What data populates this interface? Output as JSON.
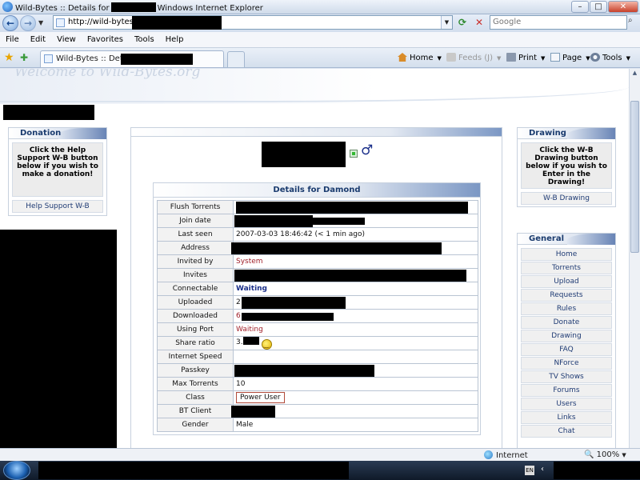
{
  "window": {
    "title_prefix": "Wild-Bytes :: Details for",
    "title_suffix": "Windows Internet Explorer"
  },
  "addressbar": {
    "url": "http://wild-bytes.org",
    "search_placeholder": "Google"
  },
  "menubar": [
    "File",
    "Edit",
    "View",
    "Favorites",
    "Tools",
    "Help"
  ],
  "tab": {
    "title": "Wild-Bytes :: Details for"
  },
  "commandbar": {
    "home": "Home",
    "feeds": "Feeds (J)",
    "print": "Print",
    "page": "Page",
    "tools": "Tools"
  },
  "site": {
    "logo": "Welcome to Wild-Bytes.org"
  },
  "donation": {
    "title": "Donation",
    "text": "Click the Help Support W-B button below if you wish to make a donation!",
    "link": "Help Support W-B"
  },
  "drawing": {
    "title": "Drawing",
    "text": "Click the W-B Drawing button below if you wish to Enter in the Drawing!",
    "link": "W-B Drawing"
  },
  "general": {
    "title": "General",
    "items": [
      "Home",
      "Torrents",
      "Upload",
      "Requests",
      "Rules",
      "Donate",
      "Drawing",
      "FAQ",
      "NForce",
      "TV Shows",
      "Forums",
      "Users",
      "Links",
      "Chat"
    ]
  },
  "details": {
    "title": "Details for Damond",
    "labels": {
      "flush": "Flush Torrents",
      "join": "Join date",
      "lastseen": "Last seen",
      "address": "Address",
      "invitedby": "Invited by",
      "invites": "Invites",
      "connectable": "Connectable",
      "uploaded": "Uploaded",
      "downloaded": "Downloaded",
      "port": "Using Port",
      "ratio": "Share ratio",
      "speed": "Internet Speed",
      "passkey": "Passkey",
      "maxtorrents": "Max Torrents",
      "class": "Class",
      "btclient": "BT Client",
      "gender": "Gender"
    },
    "values": {
      "lastseen": "2007-03-03 18:46:42 (< 1 min ago)",
      "invitedby": "System",
      "connectable": "Waiting",
      "uploaded_prefix": "2",
      "downloaded_prefix": "6",
      "port": "Waiting",
      "ratio_prefix": "3.",
      "maxtorrents": "10",
      "class": "Power User",
      "gender": "Male"
    }
  },
  "statusbar": {
    "zone": "Internet",
    "zoom": "100%"
  },
  "taskbar": {
    "lang": "EN"
  }
}
